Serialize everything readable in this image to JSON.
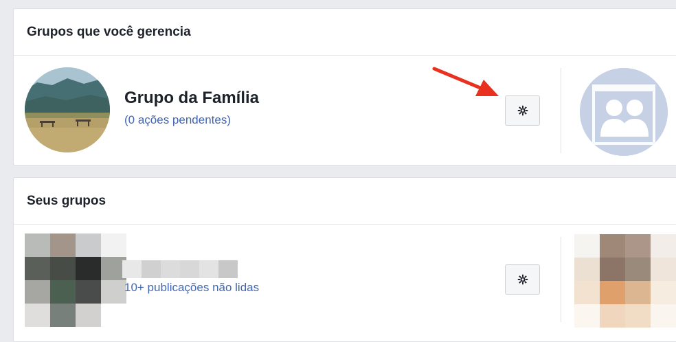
{
  "managed_section": {
    "title": "Grupos que você gerencia",
    "groups": [
      {
        "name": "Grupo da Família",
        "subtitle": "(0 ações pendentes)",
        "settings_icon": "gear-icon"
      }
    ]
  },
  "your_groups_section": {
    "title": "Seus grupos",
    "groups": [
      {
        "name": "",
        "subtitle": "10+ publicações não lidas",
        "settings_icon": "gear-icon"
      }
    ]
  },
  "colors": {
    "link_blue": "#4267b2",
    "page_bg": "#e9ebee",
    "annotation_arrow": "#e8311f",
    "placeholder_avatar": "#c7d1e6"
  }
}
